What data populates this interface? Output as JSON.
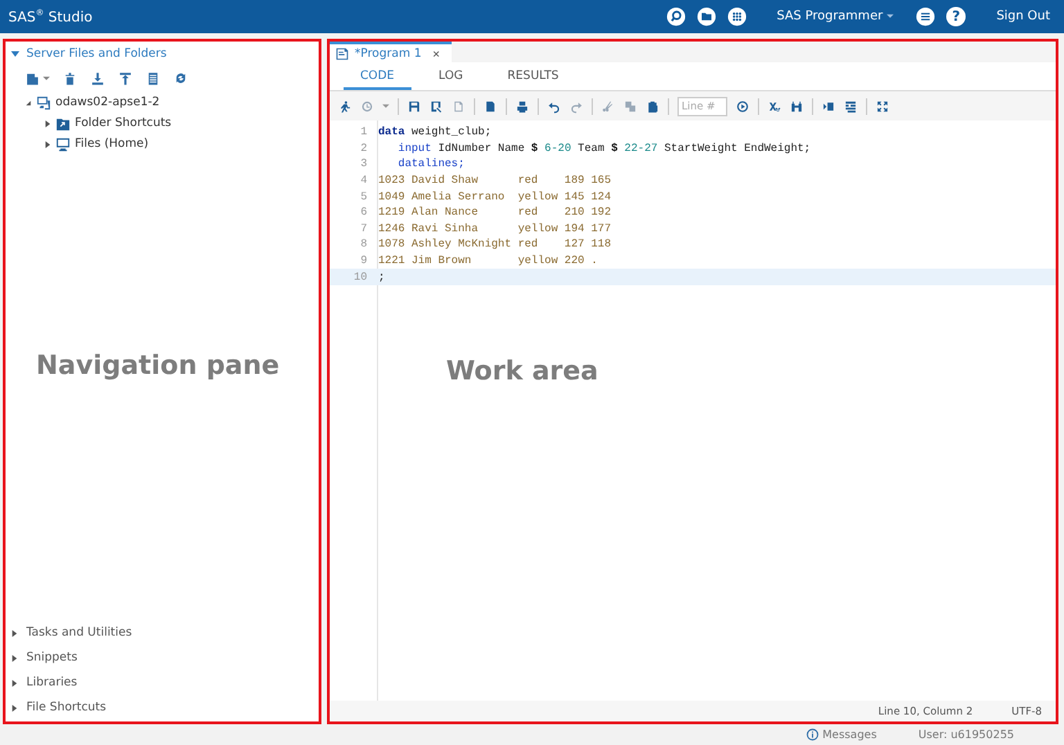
{
  "top_bar": {
    "title": "SAS$^{®}$ Studio",
    "perspective": "SAS Programmer",
    "help": "?",
    "sign_out": "Sign Out"
  },
  "navigation_pane": {
    "annotation": "Navigation pane",
    "section": {
      "label": "Server Files and Folders",
      "expanded": true
    },
    "tree": [
      {
        "label": "odaws02-apse1-2",
        "kind": "server",
        "expanded": true,
        "children": [
          {
            "label": "Folder Shortcuts",
            "kind": "folder",
            "expanded": false
          },
          {
            "label": "Files (Home)",
            "kind": "home",
            "expanded": false
          }
        ]
      }
    ],
    "bottom_sections": [
      {
        "label": "Tasks and Utilities",
        "expanded": false
      },
      {
        "label": "Snippets",
        "expanded": false
      },
      {
        "label": "Libraries",
        "expanded": false
      },
      {
        "label": "File Shortcuts",
        "expanded": false
      }
    ]
  },
  "work_area": {
    "annotation": "Work area",
    "program_tab": {
      "title": "*Program 1",
      "close": "×"
    },
    "tabs": [
      {
        "label": "CODE",
        "selected": true
      },
      {
        "label": "LOG",
        "selected": false
      },
      {
        "label": "RESULTS",
        "selected": false
      }
    ],
    "line_field": {
      "placeholder": "Line #"
    },
    "code": [
      {
        "number": "1",
        "current": false,
        "tokens": [
          {
            "text": "data",
            "kind": "keyword"
          },
          {
            "text": " weight_club;",
            "kind": "plain"
          }
        ]
      },
      {
        "number": "2",
        "current": false,
        "tokens": [
          {
            "text": "   input",
            "kind": "step"
          },
          {
            "text": " IdNumber Name ",
            "kind": "plain"
          },
          {
            "text": "$",
            "kind": "symbol"
          },
          {
            "text": " 6-20",
            "kind": "number"
          },
          {
            "text": " Team ",
            "kind": "plain"
          },
          {
            "text": "$",
            "kind": "symbol"
          },
          {
            "text": " 22-27",
            "kind": "number"
          },
          {
            "text": " StartWeight EndWeight;",
            "kind": "plain"
          }
        ]
      },
      {
        "number": "3",
        "current": false,
        "tokens": [
          {
            "text": "   datalines;",
            "kind": "step"
          }
        ]
      },
      {
        "number": "4",
        "current": false,
        "tokens": [
          {
            "text": "1023 David Shaw      red    189 165",
            "kind": "data"
          }
        ]
      },
      {
        "number": "5",
        "current": false,
        "tokens": [
          {
            "text": "1049 Amelia Serrano  yellow 145 124",
            "kind": "data"
          }
        ]
      },
      {
        "number": "6",
        "current": false,
        "tokens": [
          {
            "text": "1219 Alan Nance      red    210 192",
            "kind": "data"
          }
        ]
      },
      {
        "number": "7",
        "current": false,
        "tokens": [
          {
            "text": "1246 Ravi Sinha      yellow 194 177",
            "kind": "data"
          }
        ]
      },
      {
        "number": "8",
        "current": false,
        "tokens": [
          {
            "text": "1078 Ashley McKnight red    127 118",
            "kind": "data"
          }
        ]
      },
      {
        "number": "9",
        "current": false,
        "tokens": [
          {
            "text": "1221 Jim Brown       yellow 220 .",
            "kind": "data"
          }
        ]
      },
      {
        "number": "10",
        "current": true,
        "tokens": [
          {
            "text": ";",
            "kind": "plain"
          }
        ]
      }
    ],
    "editor_status": {
      "position": "Line 10, Column 2",
      "encoding": "UTF-8"
    }
  },
  "status_bar": {
    "messages": "Messages",
    "user": "User: u61950255"
  }
}
